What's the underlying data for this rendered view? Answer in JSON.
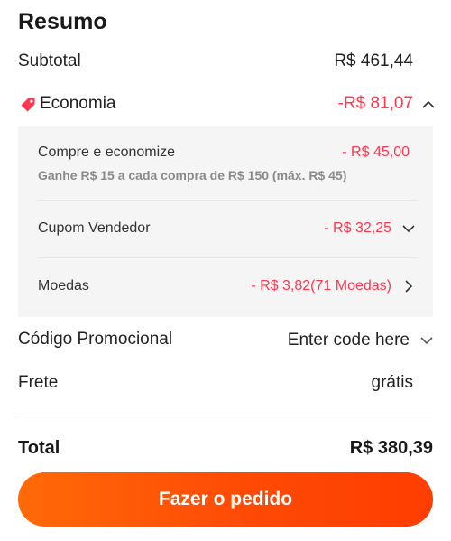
{
  "summary": {
    "title": "Resumo",
    "subtotal_label": "Subtotal",
    "subtotal_value": "R$ 461,44",
    "economy_label": "Economia",
    "economy_value": "-R$ 81,07",
    "discounts": [
      {
        "label": "Compre e economize",
        "value": "- R$ 45,00",
        "note": "Ganhe R$ 15 a cada compra de R$ 150 (máx. R$ 45)"
      },
      {
        "label": "Cupom Vendedor",
        "value": "- R$ 32,25"
      },
      {
        "label": "Moedas",
        "value": "- R$ 3,82(71 Moedas)"
      }
    ],
    "promo_label": "Código Promocional",
    "promo_placeholder": "Enter code here",
    "shipping_label": "Frete",
    "shipping_value": "grátis",
    "total_label": "Total",
    "total_value": "R$ 380,39",
    "order_button": "Fazer o pedido"
  },
  "colors": {
    "accent_red": "#fd384f",
    "button_orange": "#ff5a05"
  },
  "icons": [
    "tag-icon",
    "chevron-up-icon",
    "chevron-down-icon",
    "chevron-right-icon"
  ]
}
